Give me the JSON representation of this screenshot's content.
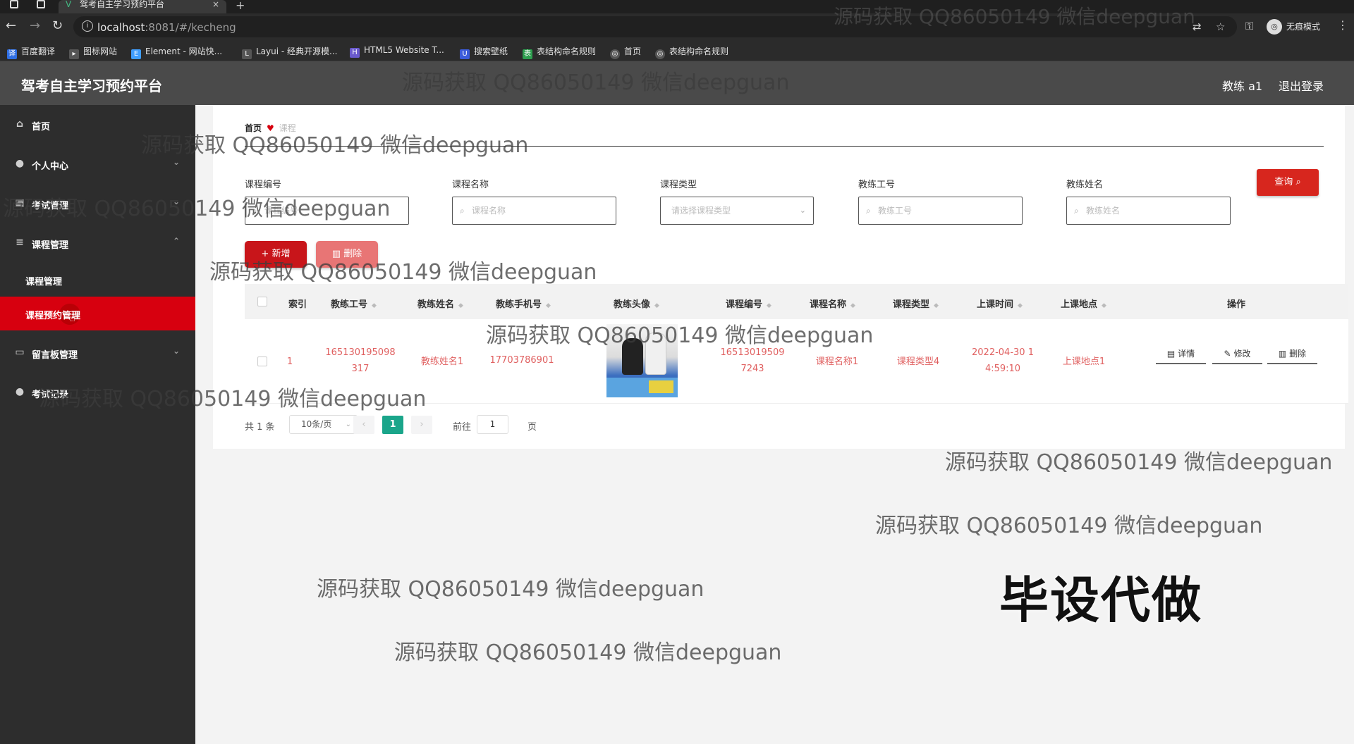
{
  "browser": {
    "tab_title": "驾考自主学习预约平台",
    "url_host": "localhost",
    "url_rest": ":8081/#/kecheng",
    "incognito_label": "无痕模式",
    "bookmarks": [
      {
        "label": "百度翻译",
        "color": "#2f6fe4"
      },
      {
        "label": "图标网站",
        "color": "#555555"
      },
      {
        "label": "Element - 网站快...",
        "color": "#409eff"
      },
      {
        "label": "Layui - 经典开源模...",
        "color": "#555555"
      },
      {
        "label": "HTML5 Website T...",
        "color": "#6a5acd"
      },
      {
        "label": "搜索壁纸",
        "color": "#3b5bdb"
      },
      {
        "label": "表结构命名规则",
        "color": "#2e9e4f"
      },
      {
        "label": "首页",
        "color": "#555555"
      },
      {
        "label": "表结构命名规则",
        "color": "#555555"
      }
    ]
  },
  "header": {
    "title": "驾考自主学习预约平台",
    "user": "教练 a1",
    "logout": "退出登录"
  },
  "sidebar": {
    "items": [
      {
        "label": "首页",
        "icon": "home-icon"
      },
      {
        "label": "个人中心",
        "icon": "user-icon"
      },
      {
        "label": "考试管理",
        "icon": "calendar-icon"
      },
      {
        "label": "课程管理",
        "icon": "menu-icon"
      },
      {
        "label": "留言板管理",
        "icon": "message-icon"
      },
      {
        "label": "考试记录",
        "icon": "location-icon"
      }
    ],
    "sub_items": [
      {
        "label": "课程管理"
      },
      {
        "label": "课程预约管理"
      }
    ]
  },
  "breadcrumb": {
    "home": "首页",
    "current": "课程"
  },
  "filters": [
    {
      "label": "课程编号",
      "placeholder": "课程编号"
    },
    {
      "label": "课程名称",
      "placeholder": "课程名称"
    },
    {
      "label": "课程类型",
      "placeholder": "请选择课程类型"
    },
    {
      "label": "教练工号",
      "placeholder": "教练工号"
    },
    {
      "label": "教练姓名",
      "placeholder": "教练姓名"
    }
  ],
  "buttons": {
    "query": "查询",
    "add": "新增",
    "delete": "删除"
  },
  "table": {
    "columns": [
      "索引",
      "教练工号",
      "教练姓名",
      "教练手机号",
      "教练头像",
      "课程编号",
      "课程名称",
      "课程类型",
      "上课时间",
      "上课地点",
      "操作"
    ],
    "rows": [
      {
        "index": "1",
        "coach_no_1": "165130195098",
        "coach_no_2": "317",
        "coach_name": "教练姓名1",
        "coach_phone": "17703786901",
        "course_no_1": "16513019509",
        "course_no_2": "7243",
        "course_name": "课程名称1",
        "course_type": "课程类型4",
        "time_1": "2022-04-30 1",
        "time_2": "4:59:10",
        "place": "上课地点1",
        "op_detail": "详情",
        "op_edit": "修改",
        "op_delete": "删除"
      }
    ]
  },
  "pagination": {
    "total": "共 1 条",
    "page_size": "10条/页",
    "current": "1",
    "goto_label": "前往",
    "goto_value": "1",
    "page_label": "页"
  },
  "watermarks": [
    "源码获取 QQ86050149 微信deepguan",
    "源码获取 QQ86050149 微信deepguan",
    "源码获取 QQ86050149 微信deepguan",
    "源码获取 QQ86050149 微信deepguan",
    "源码获取 QQ86050149 微信deepguan",
    "源码获取 QQ86050149 微信deepguan",
    "源码获取 QQ86050149 微信deepguan",
    "源码获取 QQ86050149 微信deepguan",
    "源码获取 QQ86050149 微信deepguan",
    "源码获取 QQ86050149 微信deepguan",
    "源码获取 QQ86050149 微信deepguan"
  ],
  "stamp": "毕设代做",
  "colors": {
    "accent_red": "#d7000f",
    "sidebar_bg": "#2d2d2d",
    "header_bg": "#4a4a4a",
    "pager_active": "#1aa58a"
  }
}
